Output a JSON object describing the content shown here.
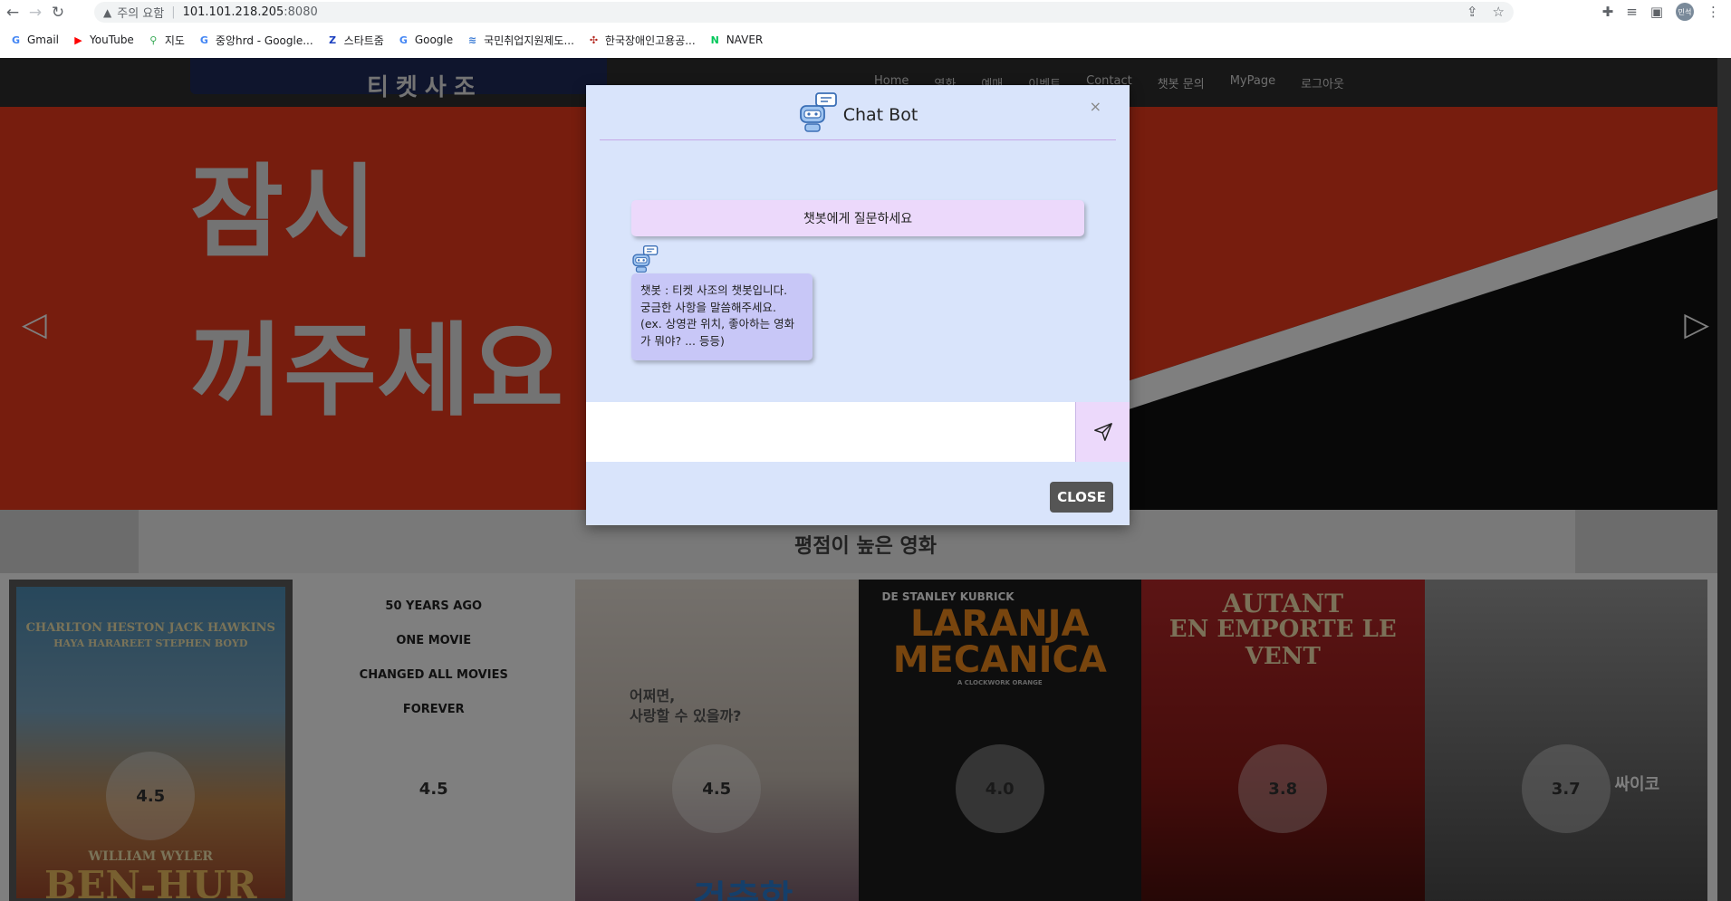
{
  "browser": {
    "security_label": "주의 요함",
    "url_host": "101.101.218.205",
    "url_port": ":8080",
    "profile_initials": "민석"
  },
  "bookmarks": [
    {
      "label": "Gmail",
      "icon": "G",
      "color": "#4285f4"
    },
    {
      "label": "YouTube",
      "icon": "▶",
      "color": "#ff0000"
    },
    {
      "label": "지도",
      "icon": "⚲",
      "color": "#34a853"
    },
    {
      "label": "중앙hrd - Google...",
      "icon": "G",
      "color": "#4285f4"
    },
    {
      "label": "스타트줌",
      "icon": "Z",
      "color": "#1a3fbf"
    },
    {
      "label": "Google",
      "icon": "G",
      "color": "#4285f4"
    },
    {
      "label": "국민취업지원제도...",
      "icon": "≋",
      "color": "#3a7bd5"
    },
    {
      "label": "한국장애인고용공...",
      "icon": "✣",
      "color": "#b3261e"
    },
    {
      "label": "NAVER",
      "icon": "N",
      "color": "#03c75a"
    }
  ],
  "site": {
    "logo": "티켓사조",
    "menu": [
      "Home",
      "영화",
      "예매",
      "이벤트",
      "Contact",
      "챗봇 문의",
      "MyPage",
      "로그아웃"
    ],
    "banner_line1": "잠시",
    "banner_line2": "꺼주세요",
    "section_title": "평점이 높은 영화"
  },
  "movies": [
    {
      "rating": "4.5",
      "poster_text": "CHARLTON HESTON  JACK HAWKINS",
      "poster_text2": "BEN-HUR",
      "poster_text3": "WILLIAM WYLER",
      "poster_text4": "HAYA HARAREET  STEPHEN BOYD"
    },
    {
      "rating": "4.5",
      "poster_text": "50 YEARS AGO",
      "poster_text2": "ONE MOVIE",
      "poster_text3": "CHANGED ALL MOVIES",
      "poster_text4": "FOREVER"
    },
    {
      "rating": "4.5",
      "poster_text": "어쩌면,",
      "poster_text2": "사랑할 수 있을까?",
      "poster_text3": "건축학",
      "poster_text4": ""
    },
    {
      "rating": "4.0",
      "poster_text": "DE STANLEY KUBRICK",
      "poster_text2": "LARANJA",
      "poster_text3": "MECANICA",
      "poster_text4": "A CLOCKWORK ORANGE"
    },
    {
      "rating": "3.8",
      "poster_text": "AUTANT",
      "poster_text2": "EN EMPORTE LE VENT",
      "poster_text3": "",
      "poster_text4": ""
    },
    {
      "rating": "3.7",
      "poster_text": "싸이코",
      "poster_text2": "",
      "poster_text3": "",
      "poster_text4": ""
    }
  ],
  "chatbot": {
    "title": "Chat Bot",
    "close_x": "×",
    "user_message": "챗봇에게 질문하세요",
    "bot_message_line1": "챗봇 : 티켓 사조의 챗봇입니다.",
    "bot_message_line2": "궁금한 사항을 말씀해주세요.",
    "bot_message_line3": "(ex. 상영관 위치, 좋아하는 영화",
    "bot_message_line4": "가 뭐야? ... 등등)",
    "input_value": "",
    "input_placeholder": "",
    "close_button": "CLOSE"
  }
}
